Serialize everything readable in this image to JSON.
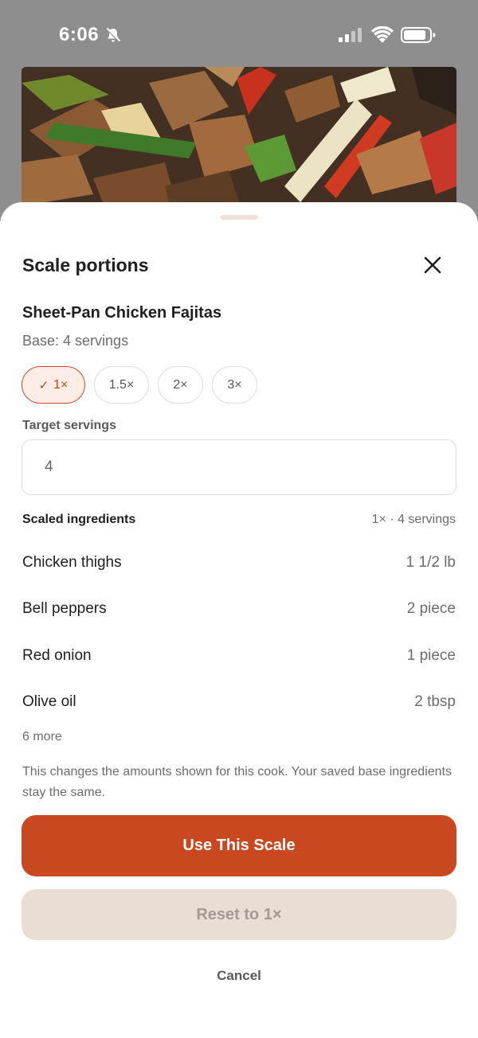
{
  "status_bar": {
    "time": "6:06"
  },
  "sheet": {
    "title": "Scale portions",
    "recipe_name": "Sheet-Pan Chicken Fajitas",
    "base_servings": "Base: 4 servings",
    "scale_options": [
      {
        "label": "1×",
        "selected": true,
        "check": "✓"
      },
      {
        "label": "1.5×",
        "selected": false
      },
      {
        "label": "2×",
        "selected": false
      },
      {
        "label": "3×",
        "selected": false
      }
    ],
    "target_label": "Target servings",
    "target_value": "4",
    "ingredients_title": "Scaled ingredients",
    "ingredients_summary": "1× · 4 servings",
    "ingredients": [
      {
        "name": "Chicken thighs",
        "qty": "1 1/2 lb"
      },
      {
        "name": "Bell peppers",
        "qty": "2 piece"
      },
      {
        "name": "Red onion",
        "qty": "1 piece"
      },
      {
        "name": "Olive oil",
        "qty": "2 tbsp"
      }
    ],
    "more_label": "6 more",
    "note": "This changes the amounts shown for this cook. Your saved base ingredients stay the same.",
    "primary_button": "Use This Scale",
    "secondary_button": "Reset to 1×",
    "cancel_button": "Cancel"
  },
  "colors": {
    "accent": "#c9481f",
    "chip_selected_bg": "#fbece6",
    "secondary_bg": "#e9ddd4"
  }
}
